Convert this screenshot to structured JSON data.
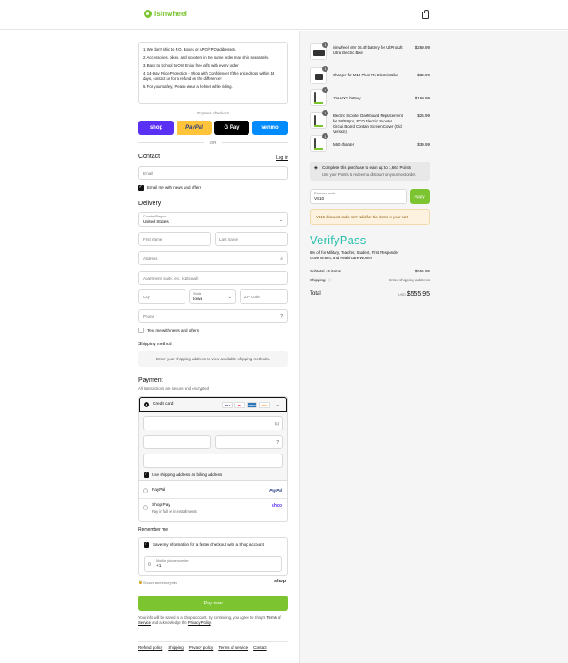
{
  "header": {
    "brand": "isinwheel"
  },
  "notice": {
    "items": [
      "1. We don't ship to P.O. Boxes or APO/FPO addresses.",
      "2. Accessories, bikes, and scooters in the same order may ship separately.",
      "3. Back to School to On! Enjoy free gifts with every order",
      "4. 14-Day Price Protection - Shop with Confidence! If the price drops within 14 days, contact us for a refund on the difference!",
      "5. For your safety, Please wear a helmet while riding."
    ]
  },
  "express": {
    "label": "Express checkout",
    "or": "OR",
    "buttons": [
      {
        "label": "shop",
        "bg": "#5a31f4",
        "color": "#ffffff"
      },
      {
        "label": "PayPal",
        "bg": "#ffc439",
        "color": "#253b80"
      },
      {
        "label": "G Pay",
        "bg": "#000000",
        "color": "#ffffff"
      },
      {
        "label": "venmo",
        "bg": "#008cff",
        "color": "#ffffff"
      }
    ]
  },
  "contact": {
    "heading": "Contact",
    "login": "Log in",
    "email_placeholder": "Email",
    "email_news": "Email me with news and offers"
  },
  "delivery": {
    "heading": "Delivery",
    "country_label": "Country/Region",
    "country_value": "United States",
    "first_name": "First name",
    "last_name": "Last name",
    "address": "Address",
    "apartment": "Apartment, suite, etc. (optional)",
    "city": "City",
    "state_label": "State",
    "state_value": "Iowa",
    "zip": "ZIP code",
    "phone": "Phone",
    "text_news": "Text me with news and offers"
  },
  "shipping": {
    "heading": "Shipping method",
    "message": "Enter your shipping address to view available shipping methods."
  },
  "payment": {
    "heading": "Payment",
    "subtitle": "All transactions are secure and encrypted.",
    "credit_card": "Credit card",
    "cards": [
      "VISA",
      "MC",
      "AMEX",
      "DISC",
      "+4"
    ],
    "billing_same": "Use shipping address as billing address",
    "paypal": "PayPal",
    "paypal_logo": "PayPal",
    "shoppay": "Shop Pay",
    "shoppay_sub": "Pay in full or in installments",
    "shoppay_logo": "shop"
  },
  "remember": {
    "heading": "Remember me",
    "save_info": "Save my information for a faster checkout with a Shop account",
    "mobile_label": "Mobile phone number",
    "mobile_value": "+1",
    "secure": "Secure and encrypted",
    "shop_logo": "shop"
  },
  "pay_now": "Pay now",
  "fine_print": {
    "text1": "Your info will be saved to a Shop account. By continuing, you agree to Shop's ",
    "tos": "Terms of Service",
    "text2": " and acknowledge the ",
    "privacy": "Privacy Policy",
    "text3": "."
  },
  "footer": [
    "Refund policy",
    "Shipping",
    "Privacy policy",
    "Terms of service",
    "Contact"
  ],
  "cart": {
    "items": [
      {
        "qty": "1",
        "name": "isinwheel 48V 16.4h battery for UltPro/Ult Ultra Electric Bike",
        "price": "$269.99",
        "thumb": "battery"
      },
      {
        "qty": "1",
        "name": "Charger for M10 Plus/ R6 Electric Bike",
        "price": "$39.99",
        "thumb": "charger"
      },
      {
        "qty": "1",
        "name": "10AH X1 battery",
        "price": "$169.99",
        "thumb": "scooter"
      },
      {
        "qty": "1",
        "name": "Electric Scooter Dashboard Replacement for S9/S9pro, ECO Electric Scooter Circuit Board Contain Screen Cover (Old Version)",
        "price": "$25.99",
        "thumb": "scooter"
      },
      {
        "qty": "1",
        "name": "M60 charger",
        "price": "$39.99",
        "thumb": "scooter"
      }
    ],
    "points_title": "Complete this purchase to earn up to 1,667 Points",
    "points_sub": "Use your Points to redeem a discount on your next order.",
    "discount_label": "Discount code",
    "discount_value": "V810",
    "apply": "Apply",
    "warning": "V810 discount code isn't valid for the items in your cart",
    "verify_brand": "VerifyPass",
    "verify_desc": "6% off for Military, Teacher, Student, First Responder Government, and Healthcare Worker",
    "subtotal_label": "Subtotal · 5 items",
    "subtotal_value": "$555.95",
    "shipping_label": "Shipping",
    "shipping_value": "Enter shipping address",
    "total_label": "Total",
    "total_currency": "USD",
    "total_value": "$555.95"
  }
}
